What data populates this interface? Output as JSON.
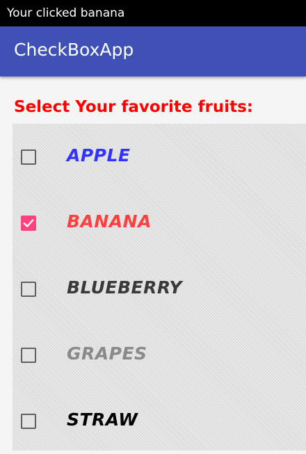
{
  "status_bar": {
    "text": "Your clicked banana"
  },
  "app_bar": {
    "title": "CheckBoxApp",
    "color": "#3f51b5"
  },
  "heading": {
    "text": "Select Your favorite fruits:",
    "color": "#ff0000"
  },
  "accent_color": "#ff4081",
  "fruits": [
    {
      "label": "APPLE",
      "checked": false,
      "color": "#3333ff"
    },
    {
      "label": "BANANA",
      "checked": true,
      "color": "#ff4040"
    },
    {
      "label": "BLUEBERRY",
      "checked": false,
      "color": "#3a3a3a"
    },
    {
      "label": "GRAPES",
      "checked": false,
      "color": "#8a8a8a"
    },
    {
      "label": "STRAW",
      "checked": false,
      "color": "#000000"
    }
  ]
}
